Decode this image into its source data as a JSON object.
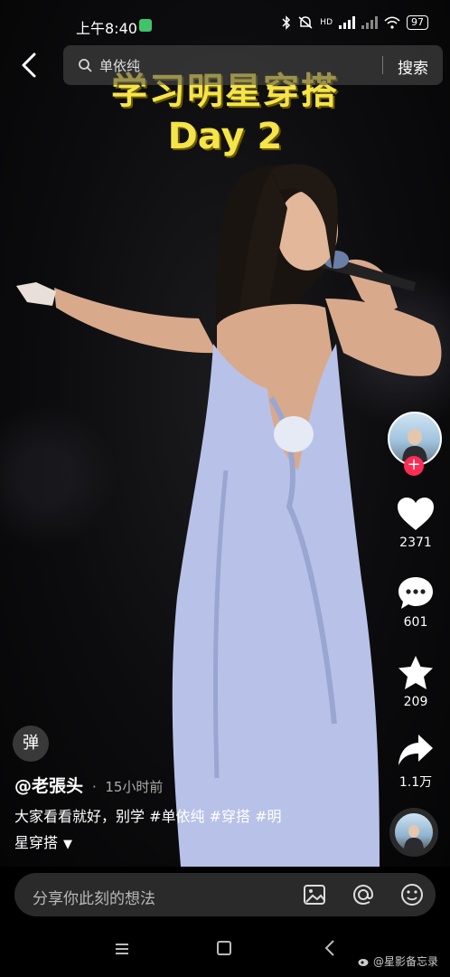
{
  "status_bar": {
    "time": "上午8:40",
    "battery": "97",
    "network_label": "HD"
  },
  "search": {
    "placeholder": "单依纯",
    "button_label": "搜索"
  },
  "video": {
    "overlay_title": "学习明星穿搭",
    "overlay_subtitle": "Day 2"
  },
  "rail": {
    "likes": "2371",
    "comments": "601",
    "favorites": "209",
    "shares": "1.1万"
  },
  "info": {
    "danmu_label": "弹",
    "author": "@老張头",
    "time_ago": "15小时前",
    "description_line1": "大家看看就好，别学 #单依纯 #穿搭 #明",
    "description_line2": "星穿搭"
  },
  "comment_bar": {
    "placeholder": "分享你此刻的想法"
  },
  "watermark": {
    "text": "@星影备忘录"
  },
  "colors": {
    "title_yellow": "#f5e44a",
    "follow_red": "#fe2c55",
    "comment_bg": "#2a2a2a"
  }
}
